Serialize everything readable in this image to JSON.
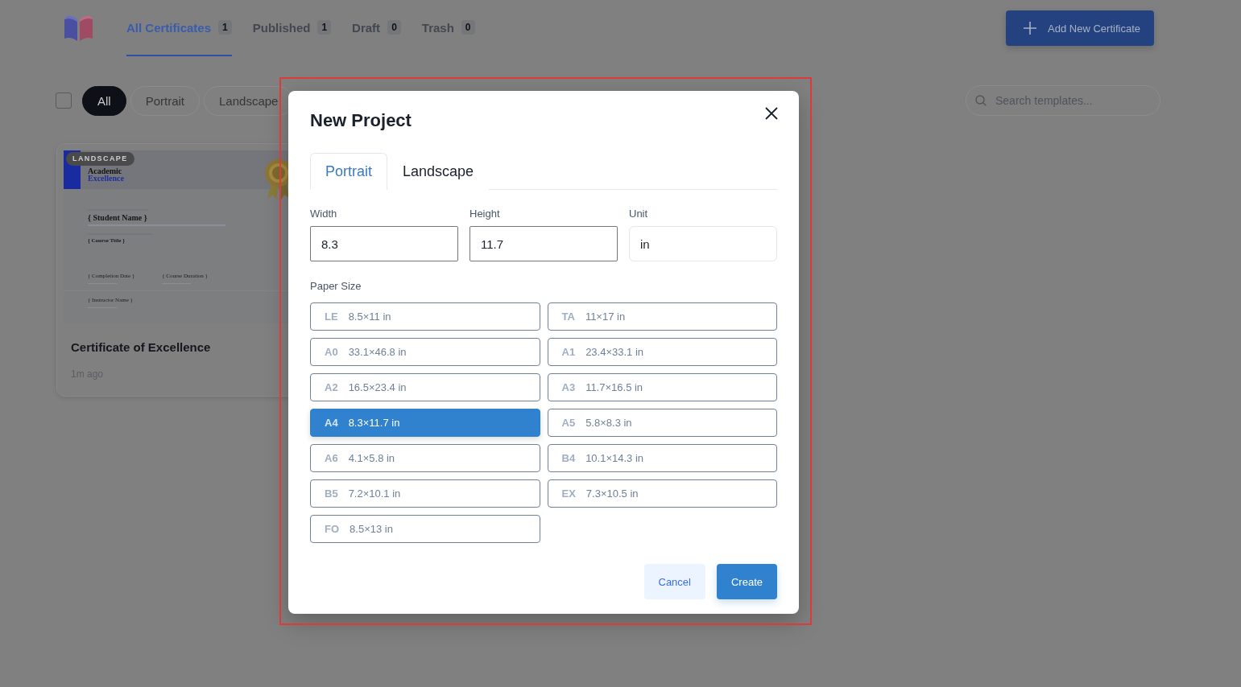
{
  "header": {
    "tabs": [
      {
        "label": "All Certificates",
        "count": "1",
        "selected": true
      },
      {
        "label": "Published",
        "count": "1",
        "selected": false
      },
      {
        "label": "Draft",
        "count": "0",
        "selected": false
      },
      {
        "label": "Trash",
        "count": "0",
        "selected": false
      }
    ],
    "add_button": {
      "label": "Add New Certificate"
    }
  },
  "filters": {
    "select_all": {
      "checked": false
    },
    "chips": [
      {
        "label": "All",
        "selected": true
      },
      {
        "label": "Portrait",
        "selected": false
      },
      {
        "label": "Landscape",
        "selected": false
      }
    ],
    "search": {
      "placeholder": "Search templates..."
    }
  },
  "cards": [
    {
      "badge": "LANDSCAPE",
      "title": "Certificate of Excellence",
      "time": "1m ago",
      "preview": {
        "heading_1": "Academic",
        "heading_2": "Excellence",
        "recipient": "{ Student Name }",
        "course": "{ Course Title }",
        "details": [
          "{ Completion Date }",
          "{ Course Duration }"
        ],
        "signer": "{ Instructor Name }"
      }
    }
  ],
  "dialog": {
    "title": "New Project",
    "tabs": [
      {
        "label": "Portrait",
        "selected": true
      },
      {
        "label": "Landscape",
        "selected": false
      }
    ],
    "fields": [
      {
        "label": "Width",
        "value": "8.3",
        "kind": "input"
      },
      {
        "label": "Height",
        "value": "11.7",
        "kind": "input"
      },
      {
        "label": "Unit",
        "value": "in",
        "kind": "select"
      }
    ],
    "paper_size_label": "Paper Size",
    "paper_sizes": [
      {
        "code": "LE",
        "size": "8.5×11 in",
        "selected": false
      },
      {
        "code": "TA",
        "size": "11×17 in",
        "selected": false
      },
      {
        "code": "A0",
        "size": "33.1×46.8 in",
        "selected": false
      },
      {
        "code": "A1",
        "size": "23.4×33.1 in",
        "selected": false
      },
      {
        "code": "A2",
        "size": "16.5×23.4 in",
        "selected": false
      },
      {
        "code": "A3",
        "size": "11.7×16.5 in",
        "selected": false
      },
      {
        "code": "A4",
        "size": "8.3×11.7 in",
        "selected": true
      },
      {
        "code": "A5",
        "size": "5.8×8.3 in",
        "selected": false
      },
      {
        "code": "A6",
        "size": "4.1×5.8 in",
        "selected": false
      },
      {
        "code": "B4",
        "size": "10.1×14.3 in",
        "selected": false
      },
      {
        "code": "B5",
        "size": "7.2×10.1 in",
        "selected": false
      },
      {
        "code": "EX",
        "size": "7.3×10.5 in",
        "selected": false
      },
      {
        "code": "FO",
        "size": "8.5×13 in",
        "selected": false
      }
    ],
    "buttons": [
      {
        "label": "Cancel",
        "kind": "secondary"
      },
      {
        "label": "Create",
        "kind": "primary"
      }
    ]
  }
}
